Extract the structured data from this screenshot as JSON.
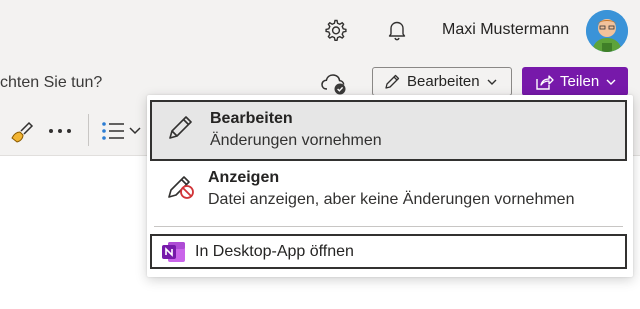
{
  "header": {
    "username": "Maxi Mustermann",
    "icons": [
      "settings-gear-icon",
      "notification-bell-icon",
      "user-avatar"
    ]
  },
  "commandbar": {
    "search_hint": "chten Sie tun?",
    "edit_button_label": "Bearbeiten",
    "share_button_label": "Teilen"
  },
  "menu": {
    "items": [
      {
        "title": "Bearbeiten",
        "subtitle": "Änderungen vornehmen",
        "icon": "pencil-icon"
      },
      {
        "title": "Anzeigen",
        "subtitle": "Datei anzeigen, aber keine Änderungen vornehmen",
        "icon": "pencil-blocked-icon"
      }
    ],
    "desktop_label": "In Desktop-App öffnen",
    "desktop_icon": "onenote-app-icon"
  },
  "colors": {
    "accent": "#7719aa",
    "chrome_bg": "#f3f2f1",
    "selected_item_bg": "#e6e6e6",
    "blocked_red": "#d13438"
  }
}
